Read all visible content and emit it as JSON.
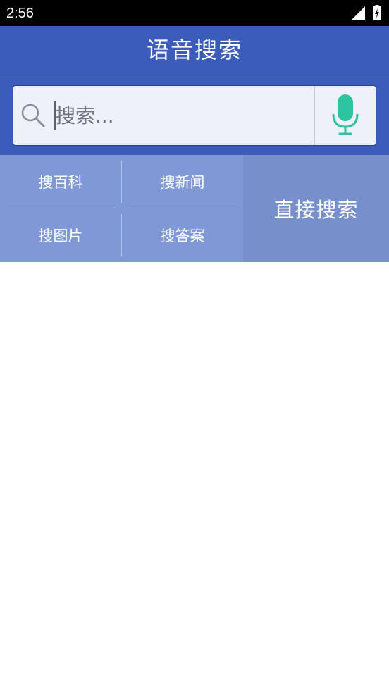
{
  "status_bar": {
    "time": "2:56",
    "icons": [
      "signal-icon",
      "battery-charging-icon"
    ]
  },
  "app_bar": {
    "title": "语音搜索"
  },
  "search": {
    "placeholder": "搜索...",
    "value": "",
    "search_icon": "search-icon",
    "mic_icon": "microphone-icon"
  },
  "options": {
    "items": [
      {
        "label": "搜百科"
      },
      {
        "label": "搜新闻"
      },
      {
        "label": "搜图片"
      },
      {
        "label": "搜答案"
      }
    ],
    "direct_search_label": "直接搜索"
  },
  "colors": {
    "app_bar": "#3b5cb8",
    "options_bg": "#7f98d6",
    "direct_search_bg": "#7790cb",
    "search_box_bg": "#eef1f8",
    "mic_accent": "#2ec4a0"
  }
}
